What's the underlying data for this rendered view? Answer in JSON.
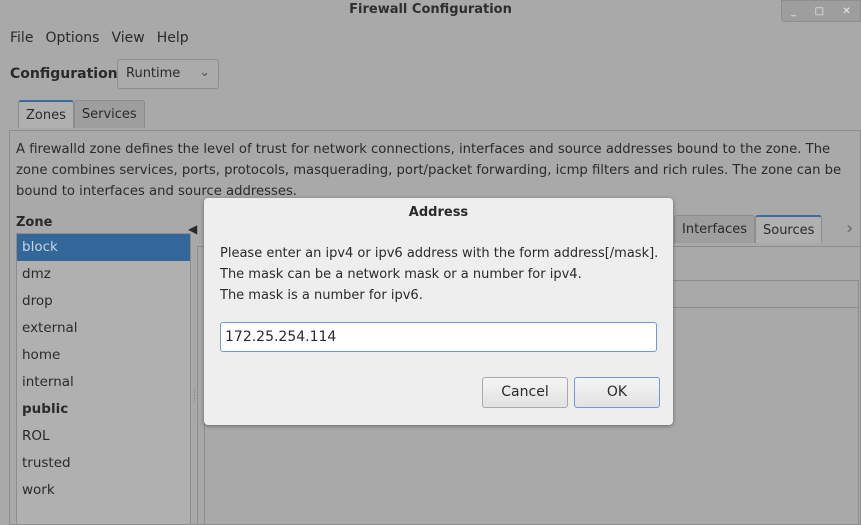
{
  "window": {
    "title": "Firewall Configuration"
  },
  "menu": [
    "File",
    "Options",
    "View",
    "Help"
  ],
  "configuration": {
    "label": "Configuration:",
    "value": "Runtime"
  },
  "main_tabs": [
    {
      "label": "Zones",
      "active": true
    },
    {
      "label": "Services",
      "active": false
    }
  ],
  "description": "A firewalld zone defines the level of trust for network connections, interfaces and source addresses bound to the zone. The zone combines services, ports, protocols, masquerading, port/packet forwarding, icmp filters and rich rules. The zone can be bound to interfaces and source addresses.",
  "zone": {
    "label": "Zone",
    "items": [
      "block",
      "dmz",
      "drop",
      "external",
      "home",
      "internal",
      "public",
      "ROL",
      "trusted",
      "work"
    ],
    "selected": "block",
    "bold": "public"
  },
  "zone_tabs": [
    {
      "label": "Interfaces",
      "active": false
    },
    {
      "label": "Sources",
      "active": true
    }
  ],
  "dialog": {
    "title": "Address",
    "message": [
      "Please enter an ipv4 or ipv6 address with the form address[/mask].",
      "The mask can be a network mask or a number for ipv4.",
      "The mask is a number for ipv6."
    ],
    "input_value": "172.25.254.114",
    "cancel": "Cancel",
    "ok": "OK"
  },
  "colors": {
    "selection": "#336699",
    "focus": "#6f9bd1"
  }
}
